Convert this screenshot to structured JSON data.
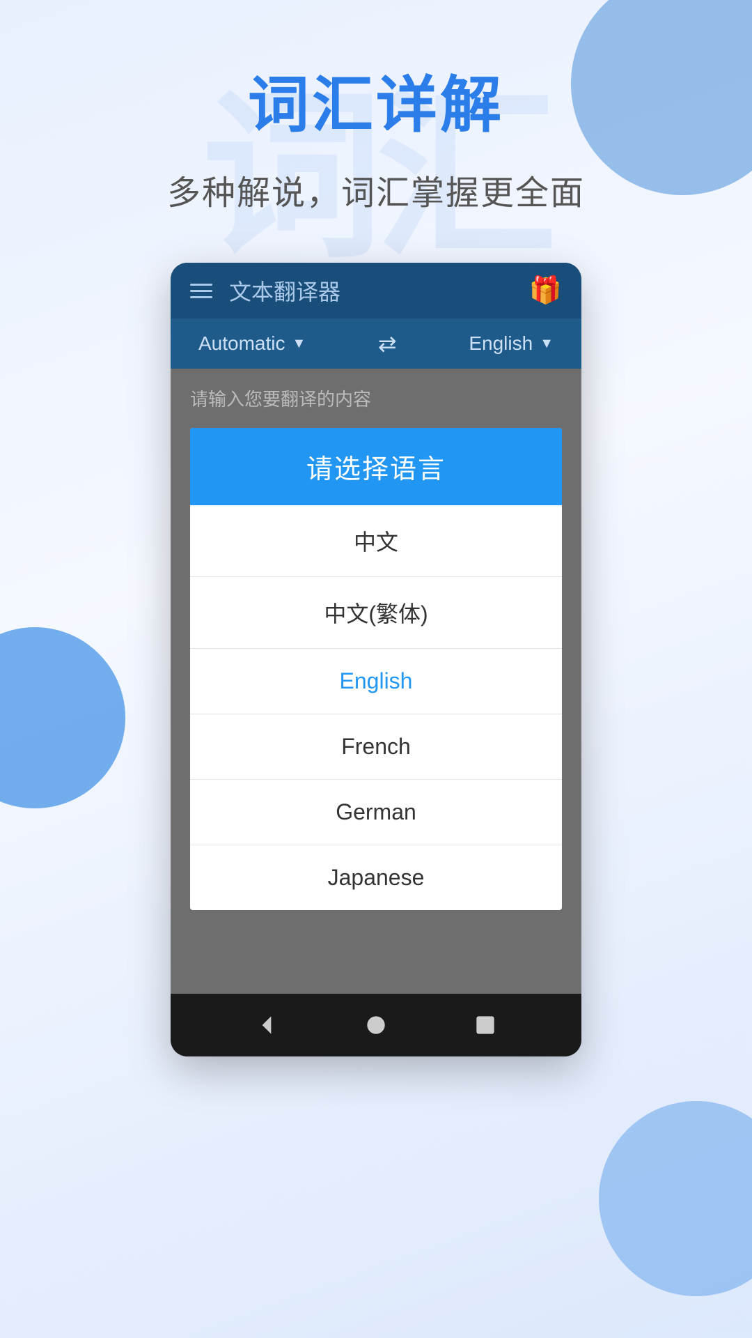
{
  "page": {
    "background": {
      "watermark_text": "词汇"
    },
    "hero": {
      "title": "词汇详解",
      "subtitle": "多种解说，词汇掌握更全面"
    },
    "app": {
      "appbar": {
        "menu_icon": "≡",
        "title": "文本翻译器",
        "gift_icon": "🎁"
      },
      "lang_bar": {
        "source_lang": "Automatic",
        "swap_icon": "⇄",
        "target_lang": "English"
      },
      "text_input": {
        "placeholder": "请输入您要翻译的内容"
      },
      "dialog": {
        "title": "请选择语言",
        "options": [
          {
            "label": "中文",
            "selected": false
          },
          {
            "label": "中文(繁体)",
            "selected": false
          },
          {
            "label": "English",
            "selected": true
          },
          {
            "label": "French",
            "selected": false
          },
          {
            "label": "German",
            "selected": false
          },
          {
            "label": "Japanese",
            "selected": false
          }
        ]
      },
      "navbar": {
        "back_label": "◀",
        "home_label": "⬤",
        "recent_label": "⬛"
      }
    }
  }
}
